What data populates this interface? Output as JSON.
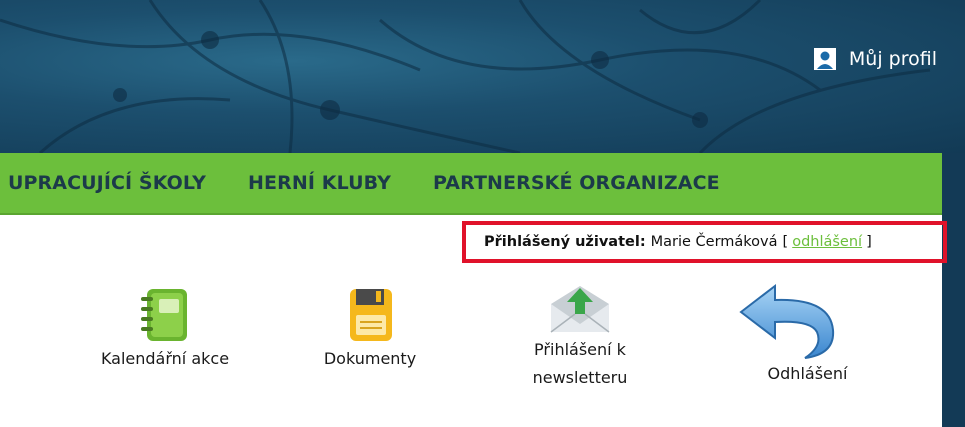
{
  "header": {
    "profile_label": "Můj profil"
  },
  "nav": {
    "items": [
      {
        "label": "UPRACUJÍCÍ ŠKOLY"
      },
      {
        "label": "HERNÍ KLUBY"
      },
      {
        "label": "PARTNERSKÉ ORGANIZACE"
      }
    ]
  },
  "user_status": {
    "label": "Přihlášený uživatel:",
    "name": "Marie Čermáková",
    "open_bracket": "[",
    "logout_link": "odhlášení",
    "close_bracket": "]"
  },
  "tiles": [
    {
      "label": "Kalendářní akce",
      "icon": "calendar-notebook-icon"
    },
    {
      "label": "Dokumenty",
      "icon": "floppy-disk-icon"
    },
    {
      "label_line1": "Přihlášení k",
      "label_line2": "newsletteru",
      "icon": "envelope-upload-icon"
    },
    {
      "label": "Odhlášení",
      "icon": "back-arrow-icon"
    }
  ],
  "colors": {
    "nav_green": "#6cbf3c",
    "header_blue": "#1c4f6e",
    "highlight_red": "#e0122a"
  }
}
